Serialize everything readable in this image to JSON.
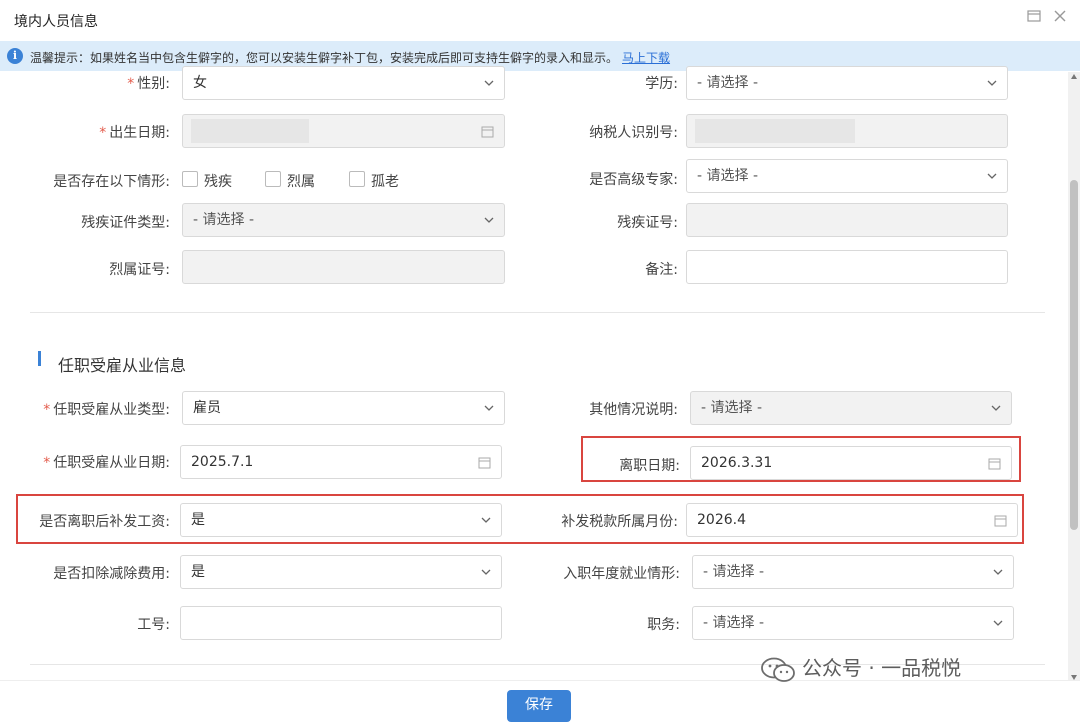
{
  "window": {
    "title": "境内人员信息"
  },
  "tip": {
    "text": "温馨提示：如果姓名当中包含生僻字的，您可以安装生僻字补丁包，安装完成后即可支持生僻字的录入和显示。",
    "link": "马上下载"
  },
  "form": {
    "gender": {
      "label": "性别:",
      "value": "女"
    },
    "education": {
      "label": "学历:",
      "value": "- 请选择 -"
    },
    "birth_date": {
      "label": "出生日期:"
    },
    "taxpayer_id": {
      "label": "纳税人识别号:"
    },
    "conditions": {
      "label": "是否存在以下情形:",
      "options": [
        "残疾",
        "烈属",
        "孤老"
      ]
    },
    "senior_expert": {
      "label": "是否高级专家:",
      "value": "- 请选择 -"
    },
    "disability_cert_type": {
      "label": "残疾证件类型:",
      "value": "- 请选择 -"
    },
    "disability_cert_no": {
      "label": "残疾证号:"
    },
    "martyr_cert_no": {
      "label": "烈属证号:"
    },
    "remark": {
      "label": "备注:"
    }
  },
  "section": {
    "title": "任职受雇从业信息"
  },
  "employment": {
    "type": {
      "label": "任职受雇从业类型:",
      "value": "雇员"
    },
    "other_note": {
      "label": "其他情况说明:",
      "value": "- 请选择 -"
    },
    "start_date": {
      "label": "任职受雇从业日期:",
      "value": "2025.7.1"
    },
    "leave_date": {
      "label": "离职日期:",
      "value": "2026.3.31"
    },
    "back_pay": {
      "label": "是否离职后补发工资:",
      "value": "是"
    },
    "back_pay_month": {
      "label": "补发税款所属月份:",
      "value": "2026.4"
    },
    "deduct_fee": {
      "label": "是否扣除减除费用:",
      "value": "是"
    },
    "entry_year": {
      "label": "入职年度就业情形:",
      "value": "- 请选择 -"
    },
    "job_no": {
      "label": "工号:"
    },
    "position": {
      "label": "职务:",
      "value": "- 请选择 -"
    }
  },
  "footer": {
    "save": "保存"
  },
  "watermark": {
    "text": "公众号 · 一品税悦"
  },
  "colors": {
    "primary": "#3b82d6",
    "highlight": "#d9453f",
    "required": "#e35b4b",
    "tip_bg": "#dcecfa"
  }
}
